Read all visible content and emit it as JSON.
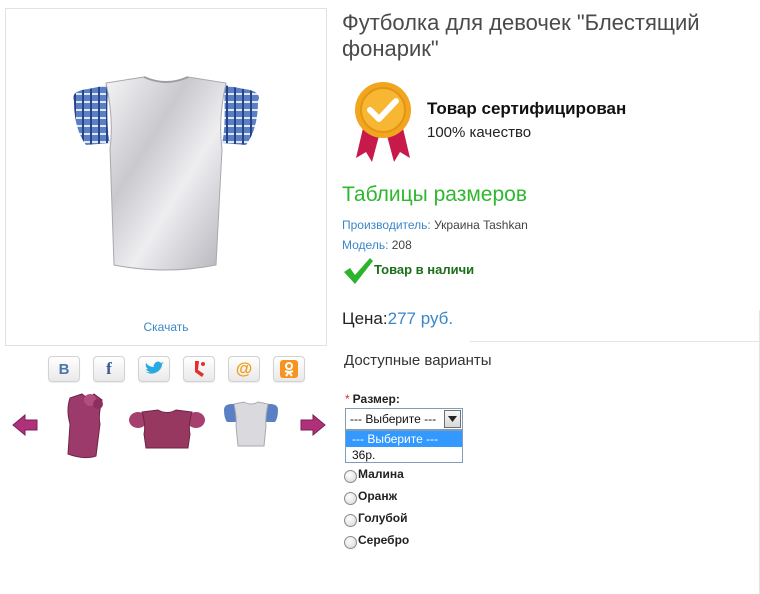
{
  "gallery": {
    "download_label": "Скачать"
  },
  "share_buttons": [
    {
      "icon": "vk-icon",
      "label": "В"
    },
    {
      "icon": "facebook-icon",
      "label": "f"
    },
    {
      "icon": "twitter-icon"
    },
    {
      "icon": "livejournal-icon"
    },
    {
      "icon": "mail-ru-icon",
      "label": "@"
    },
    {
      "icon": "odnoklassniki-icon"
    }
  ],
  "product": {
    "title": "Футболка для девочек \"Блестящий фонарик\"",
    "certificate": {
      "title": "Товар сертифицирован",
      "subtitle": "100% качество"
    },
    "size_tables_link": "Таблицы размеров",
    "manufacturer_label": "Производитель:",
    "manufacturer_value": " Украина Tashkan",
    "model_label": "Модель:",
    "model_value": " 208",
    "stock_status": "Товар в наличи",
    "price_label": "Цена:",
    "price_value": "277 руб."
  },
  "options": {
    "title": "Доступные варианты",
    "size_required_mark": "*",
    "size_label": "Размер:",
    "size_selected": "--- Выберите ---",
    "size_options": [
      "--- Выберите ---",
      "36р."
    ],
    "colors": [
      "Малина",
      "Оранж",
      "Голубой",
      "Серебро"
    ]
  },
  "colors": {
    "link": "#3a87c8",
    "accent_green": "#2db82d",
    "stock_green": "#1b6e1b",
    "dropdown_highlight": "#3399ff",
    "required_red": "#e0301e"
  }
}
